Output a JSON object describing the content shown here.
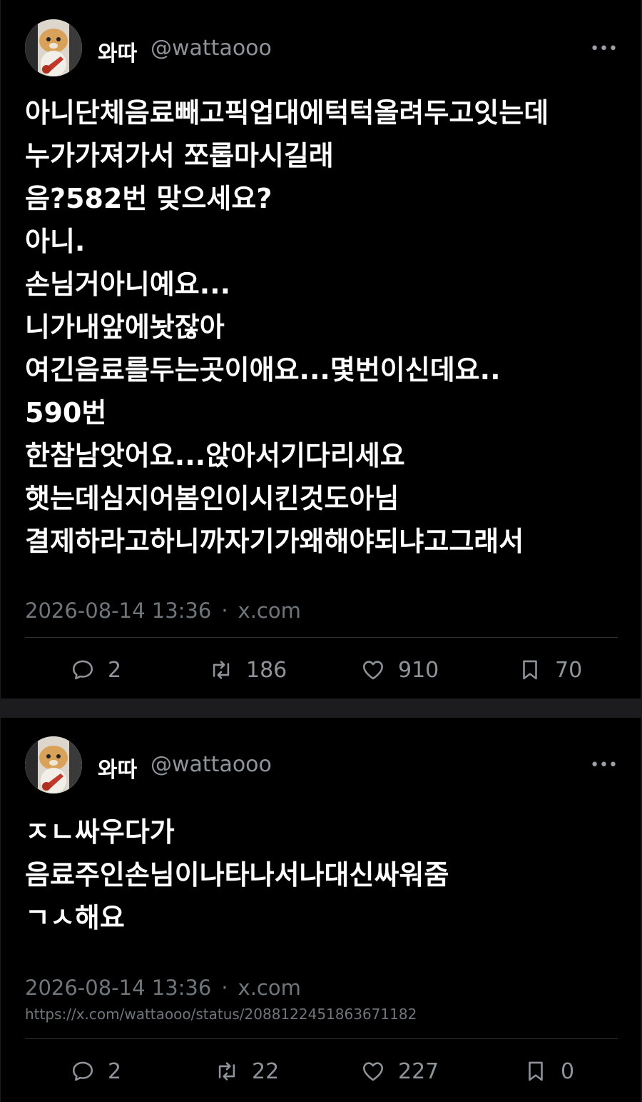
{
  "tweets": [
    {
      "author_name": "와따",
      "author_handle": "@wattaooo",
      "more_icon": "more-icon",
      "lines": [
        "아니단체음료빼고픽업대에턱턱올려두고잇는데",
        "누가가져가서 쪼롭마시길래",
        "음?582번 맞으세요?",
        "아니.",
        "손님거아니예요...",
        "니가내앞에놧잖아",
        "여긴음료를두는곳이애요...몇번이신데요..",
        "590번",
        "한참남앗어요...앉아서기다리세요",
        "햇는데심지어봄인이시킨것도아님",
        "결제하라고하니까자기가왜해야되냐고그래서"
      ],
      "timestamp": "2026-08-14 13:36",
      "separator": "·",
      "source": "x.com",
      "url": "",
      "reply_count": "2",
      "retweet_count": "186",
      "like_count": "910",
      "bookmark_count": "70"
    },
    {
      "author_name": "와따",
      "author_handle": "@wattaooo",
      "more_icon": "more-icon",
      "lines": [
        "ㅈㄴ싸우다가",
        "음료주인손님이나타나서나대신싸워줌",
        "ㄱㅅ해요"
      ],
      "timestamp": "2026-08-14 13:36",
      "separator": "·",
      "source": "x.com",
      "url": "https://x.com/wattaooo/status/2088122451863671182",
      "reply_count": "2",
      "retweet_count": "22",
      "like_count": "227",
      "bookmark_count": "0"
    }
  ],
  "colors": {
    "background": "#000000",
    "gap": "#1c1c1e",
    "text": "#ffffff",
    "muted": "#6f767b",
    "icon": "#8f949a"
  }
}
